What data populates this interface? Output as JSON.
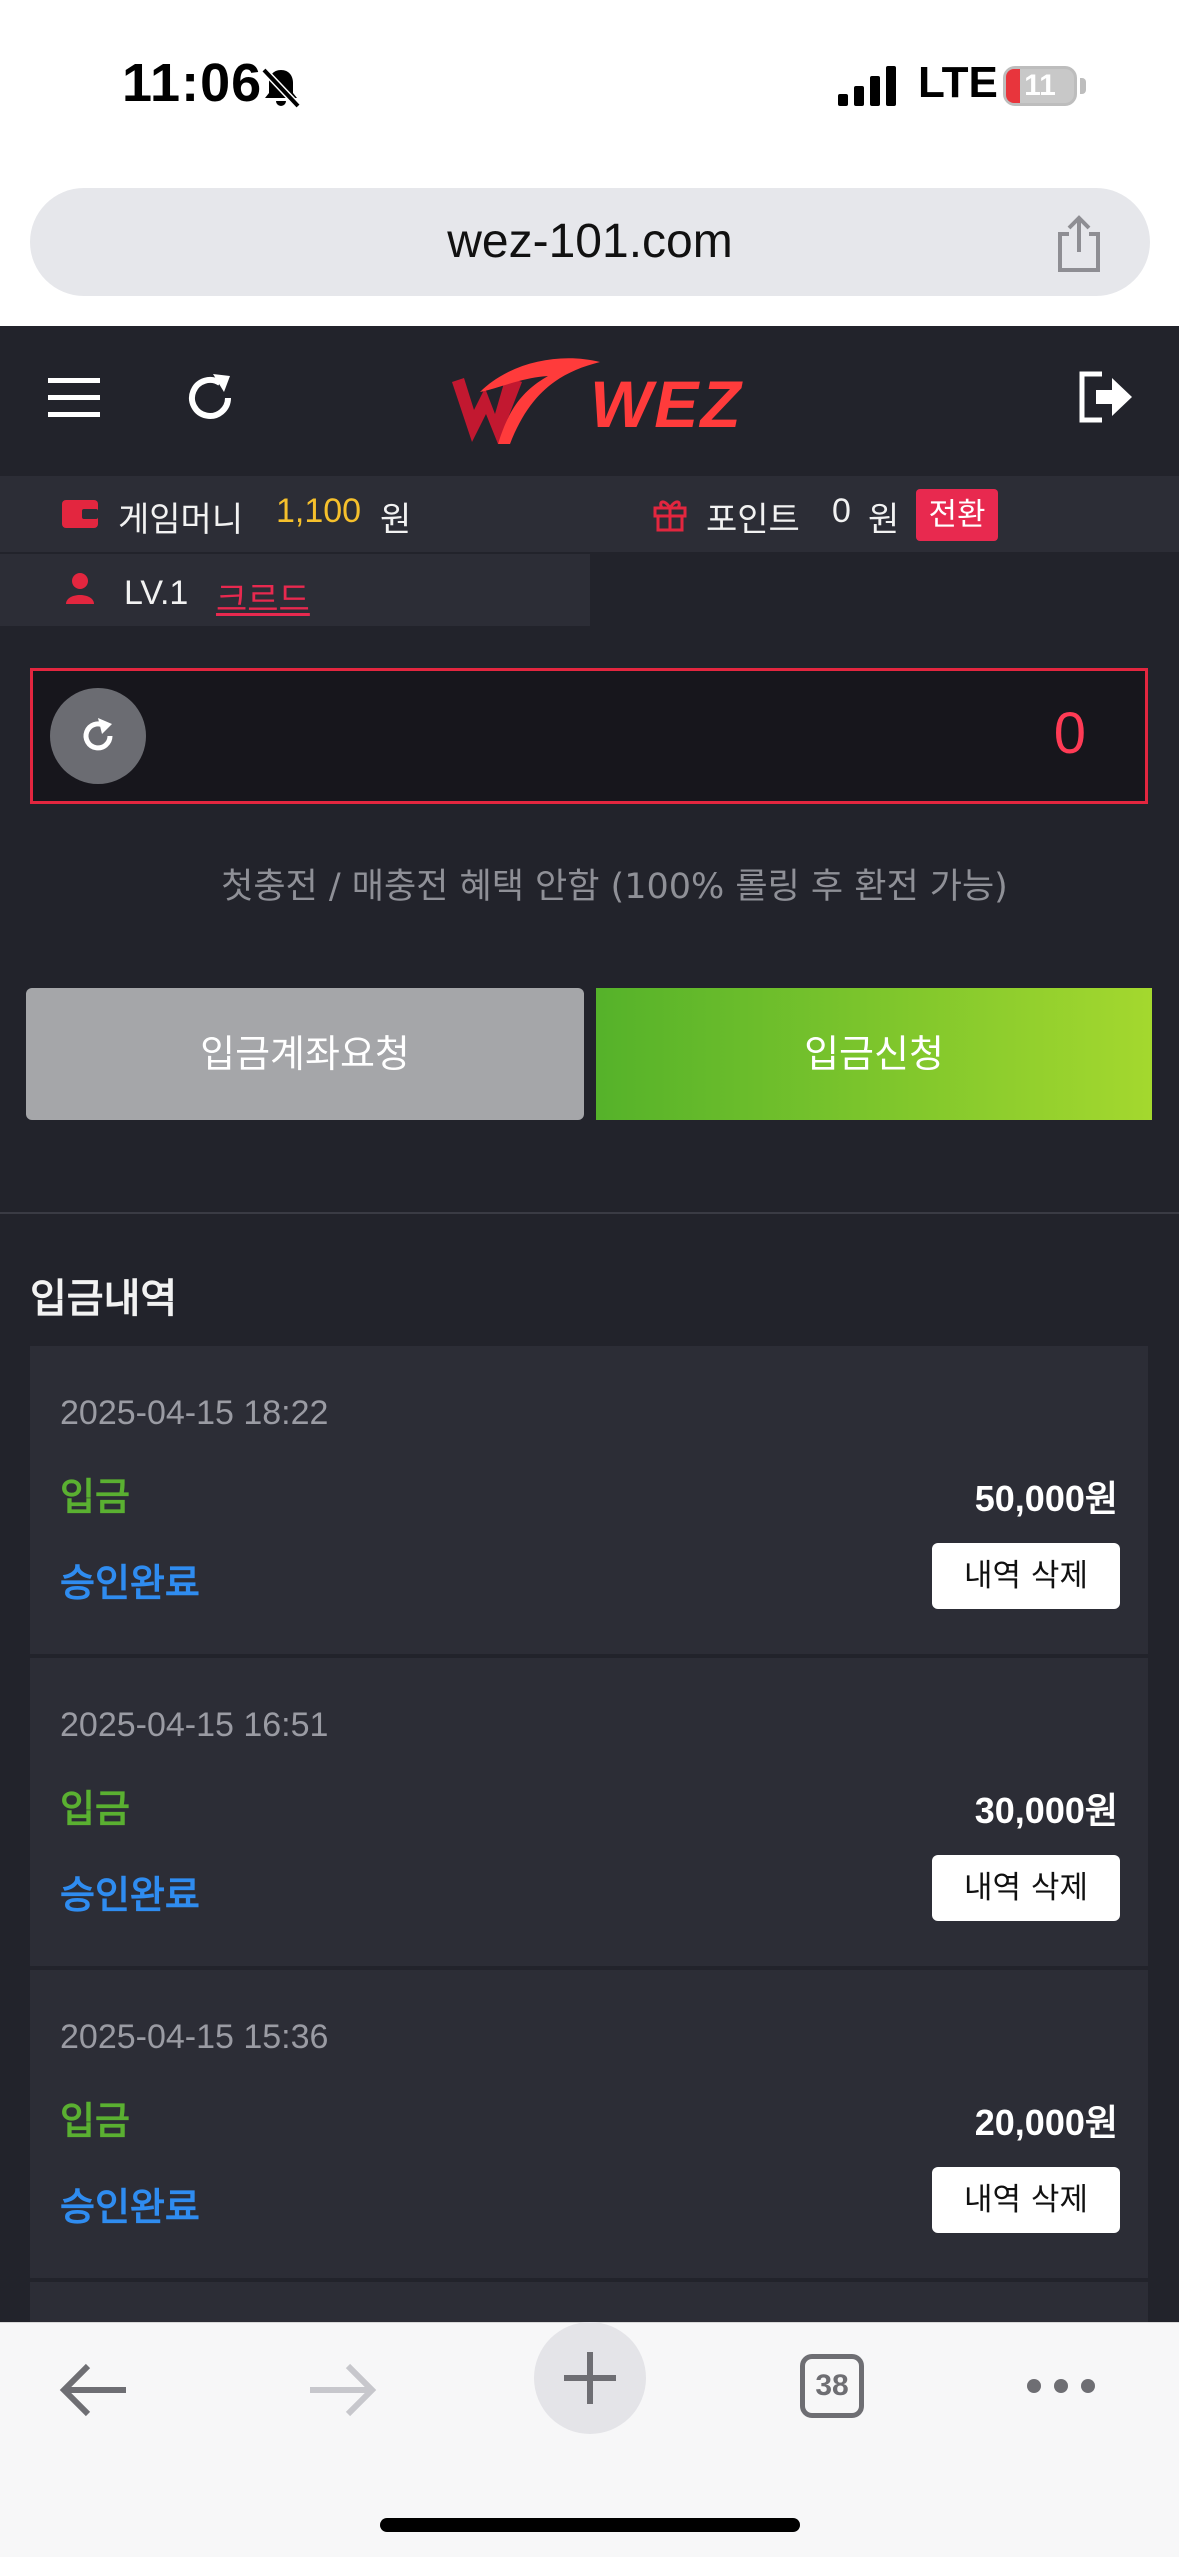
{
  "status_bar": {
    "time": "11:06",
    "network": "LTE",
    "battery": "11"
  },
  "browser": {
    "url": "wez-101.com",
    "tab_count": "38"
  },
  "header": {
    "logo_text": "WEZ"
  },
  "account": {
    "game_money_label": "게임머니",
    "game_money_value": "1,100",
    "game_money_unit": "원",
    "point_label": "포인트",
    "point_value": "0",
    "point_unit": "원",
    "convert_label": "전환",
    "level": "LV.1",
    "grade": "크르드"
  },
  "deposit": {
    "amount": "0",
    "notice": "첫충전 / 매충전 혜택 안함 (100% 롤링 후 환전 가능)",
    "account_request_label": "입금계좌요청",
    "deposit_request_label": "입금신청"
  },
  "history": {
    "title": "입금내역",
    "items": [
      {
        "datetime": "2025-04-15 18:22",
        "type": "입금",
        "amount": "50,000원",
        "status": "승인완료",
        "delete_label": "내역 삭제"
      },
      {
        "datetime": "2025-04-15 16:51",
        "type": "입금",
        "amount": "30,000원",
        "status": "승인완료",
        "delete_label": "내역 삭제"
      },
      {
        "datetime": "2025-04-15 15:36",
        "type": "입금",
        "amount": "20,000원",
        "status": "승인완료",
        "delete_label": "내역 삭제"
      }
    ]
  },
  "colors": {
    "accent_red": "#e3263f",
    "money_yellow": "#f6c02c",
    "green": "#5ab031",
    "blue": "#2f8cf0"
  }
}
